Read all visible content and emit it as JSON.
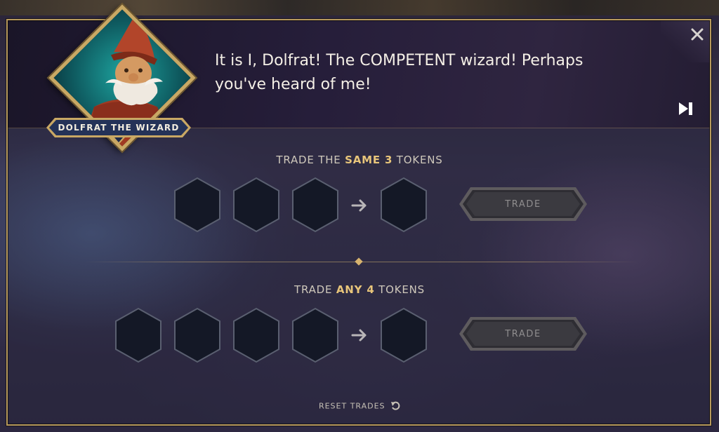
{
  "dialog": {
    "speaker_name": "DOLFRAT THE WIZARD",
    "text": "It is I, Dolfrat! The COMPETENT wizard! Perhaps you've heard of me!",
    "close_icon": "close-icon",
    "skip_icon": "skip-forward-icon"
  },
  "trades": [
    {
      "title_prefix": "TRADE THE ",
      "title_highlight": "SAME 3",
      "title_suffix": " TOKENS",
      "input_slots": 3,
      "button_label": "TRADE"
    },
    {
      "title_prefix": "TRADE ",
      "title_highlight": "ANY 4",
      "title_suffix": " TOKENS",
      "input_slots": 4,
      "button_label": "TRADE"
    }
  ],
  "reset": {
    "label": "RESET TRADES",
    "icon": "undo-icon"
  },
  "colors": {
    "gold": "#c9a864",
    "highlight": "#e8c57a",
    "portrait_bg": "#1ea5a0"
  }
}
